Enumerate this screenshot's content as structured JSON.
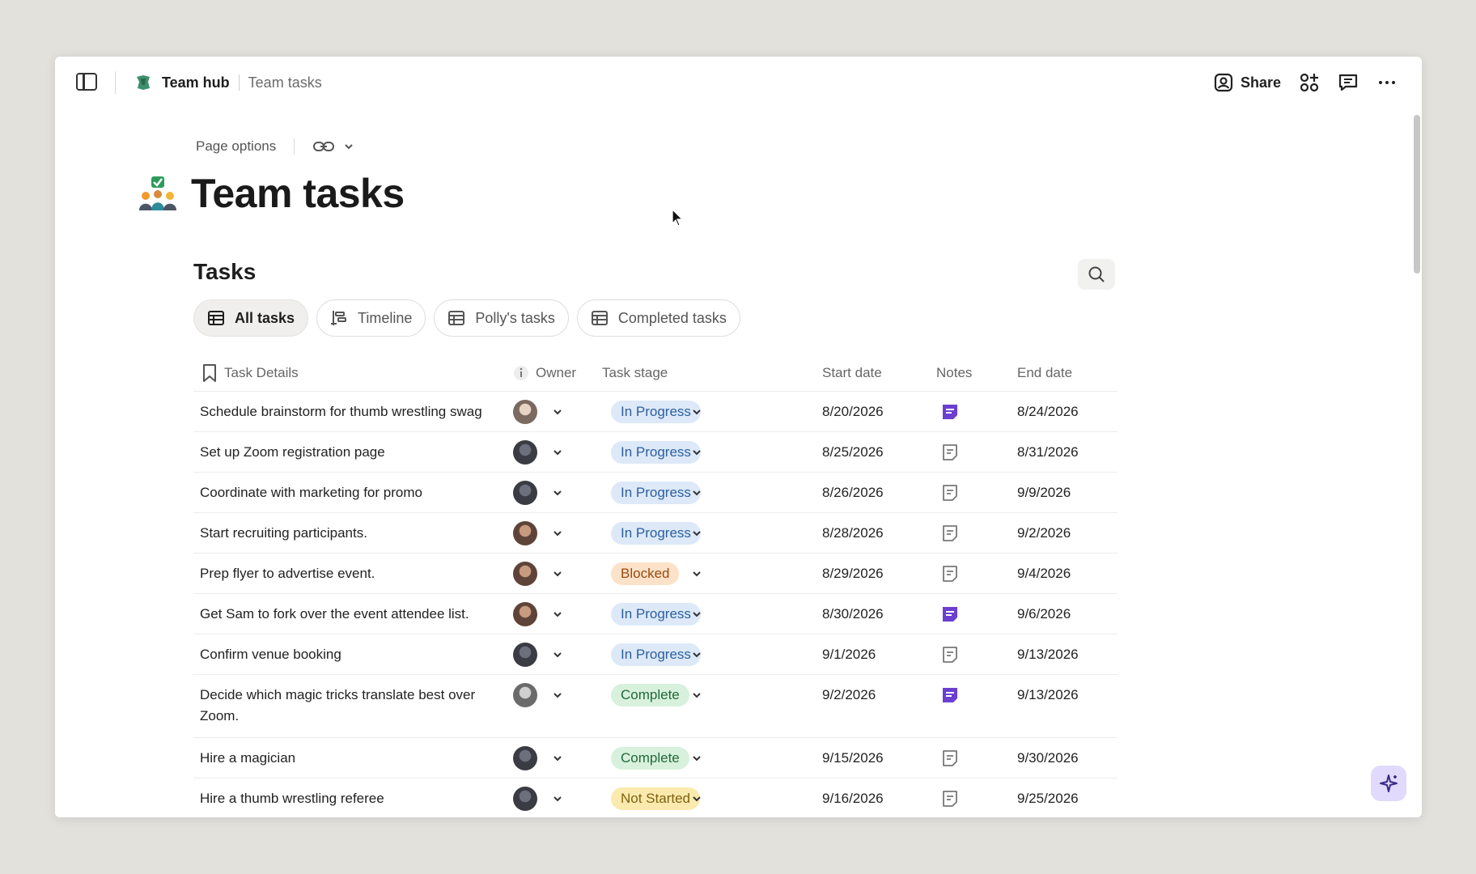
{
  "topbar": {
    "hub_name": "Team hub",
    "page_name": "Team tasks",
    "share_label": "Share"
  },
  "page": {
    "options_label": "Page options",
    "title": "Team tasks"
  },
  "section": {
    "title": "Tasks"
  },
  "tabs": [
    {
      "label": "All tasks",
      "icon": "table-icon",
      "active": true
    },
    {
      "label": "Timeline",
      "icon": "timeline-icon",
      "active": false
    },
    {
      "label": "Polly's tasks",
      "icon": "table-icon",
      "active": false
    },
    {
      "label": "Completed tasks",
      "icon": "table-icon",
      "active": false
    }
  ],
  "columns": {
    "task": "Task Details",
    "owner": "Owner",
    "stage": "Task stage",
    "start": "Start date",
    "notes": "Notes",
    "end": "End date"
  },
  "colors": {
    "in_progress_bg": "#dde9f8",
    "blocked_bg": "#fbe2c9",
    "complete_bg": "#d7f1dc",
    "not_started_bg": "#fbeaae",
    "note_filled": "#6b3fd0"
  },
  "rows": [
    {
      "task": "Schedule brainstorm for thumb wrestling swag",
      "stage": "In Progress",
      "start": "8/20/2026",
      "end": "8/24/2026",
      "note_filled": true
    },
    {
      "task": "Set up Zoom registration page",
      "stage": "In Progress",
      "start": "8/25/2026",
      "end": "8/31/2026",
      "note_filled": false
    },
    {
      "task": "Coordinate with marketing for promo",
      "stage": "In Progress",
      "start": "8/26/2026",
      "end": "9/9/2026",
      "note_filled": false
    },
    {
      "task": "Start recruiting participants.",
      "stage": "In Progress",
      "start": "8/28/2026",
      "end": "9/2/2026",
      "note_filled": false
    },
    {
      "task": "Prep flyer to advertise event.",
      "stage": "Blocked",
      "start": "8/29/2026",
      "end": "9/4/2026",
      "note_filled": false
    },
    {
      "task": "Get Sam to fork over the event attendee list.",
      "stage": "In Progress",
      "start": "8/30/2026",
      "end": "9/6/2026",
      "note_filled": true
    },
    {
      "task": "Confirm venue booking",
      "stage": "In Progress",
      "start": "9/1/2026",
      "end": "9/13/2026",
      "note_filled": false
    },
    {
      "task": "Decide which magic tricks translate best over Zoom.",
      "stage": "Complete",
      "start": "9/2/2026",
      "end": "9/13/2026",
      "note_filled": true
    },
    {
      "task": "Hire a magician",
      "stage": "Complete",
      "start": "9/15/2026",
      "end": "9/30/2026",
      "note_filled": false
    },
    {
      "task": "Hire a thumb wrestling referee",
      "stage": "Not Started",
      "start": "9/16/2026",
      "end": "9/25/2026",
      "note_filled": false
    }
  ]
}
